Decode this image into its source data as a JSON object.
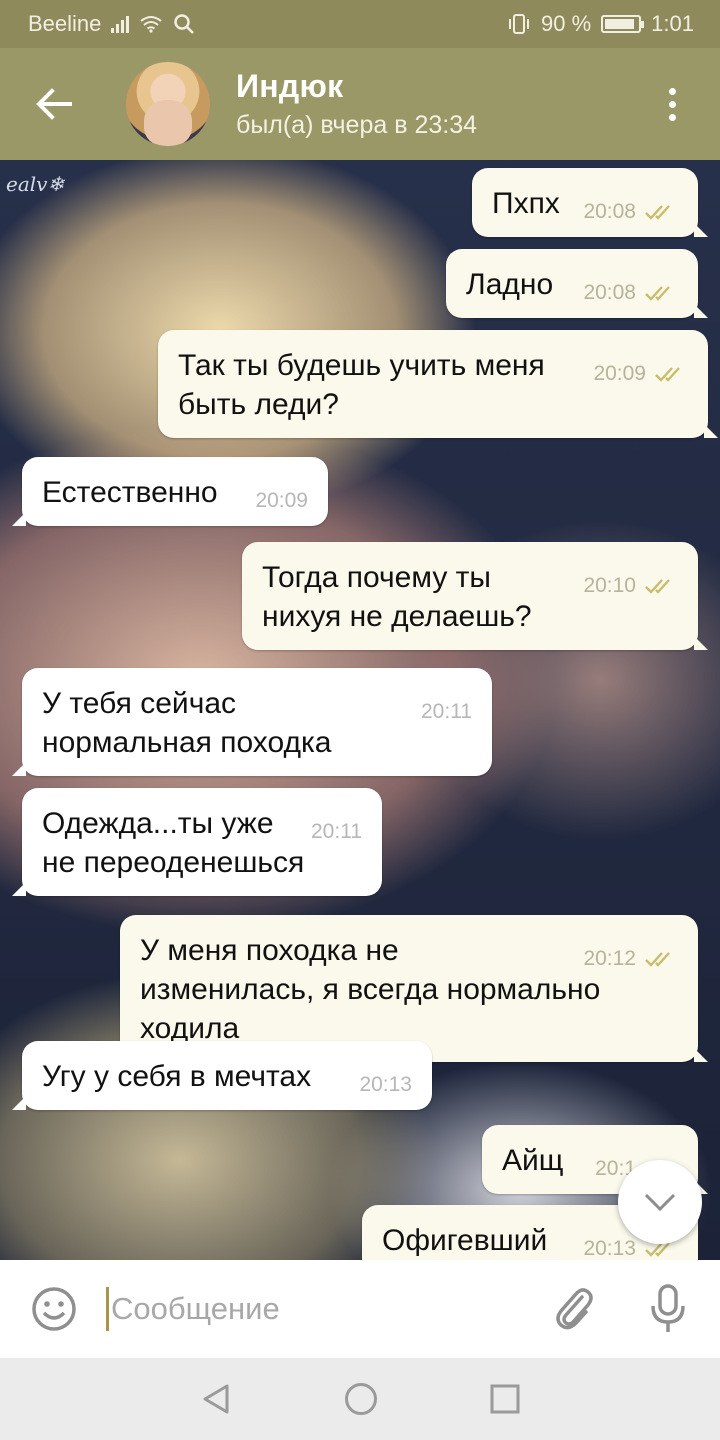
{
  "status_bar": {
    "carrier": "Beeline",
    "battery_percent": "90 %",
    "battery_level": 0.9,
    "time": "1:01"
  },
  "header": {
    "contact_name": "Индюк",
    "last_seen": "был(а) вчера в 23:34"
  },
  "wallpaper": {
    "watermark": "ealv❄"
  },
  "messages": [
    {
      "direction": "out",
      "text": "Пхпх",
      "time": "20:08",
      "status": "read"
    },
    {
      "direction": "out",
      "text": "Ладно",
      "time": "20:08",
      "status": "read"
    },
    {
      "direction": "out",
      "text": "Так ты будешь учить меня быть леди?",
      "time": "20:09",
      "status": "read"
    },
    {
      "direction": "in",
      "text": "Естественно",
      "time": "20:09"
    },
    {
      "direction": "out",
      "text": "Тогда почему ты нихуя не делаешь?",
      "time": "20:10",
      "status": "read"
    },
    {
      "direction": "in",
      "text": "У тебя сейчас нормальная походка",
      "time": "20:11"
    },
    {
      "direction": "in",
      "text": "Одежда...ты уже не переоденешься",
      "time": "20:11"
    },
    {
      "direction": "out",
      "text": "У меня походка не изменилась, я всегда нормально ходила",
      "time": "20:12",
      "status": "read"
    },
    {
      "direction": "in",
      "text": "Угу у себя в мечтах",
      "time": "20:13"
    },
    {
      "direction": "out",
      "text": "Айщ",
      "time": "20:1",
      "status": "read"
    },
    {
      "direction": "out",
      "text": "Офигевший",
      "time": "20:13",
      "status": "read"
    }
  ],
  "composer": {
    "placeholder": "Сообщение"
  },
  "colors": {
    "header": "#9b9867",
    "status_bar": "#8e8a5c",
    "outgoing_bubble": "#fbf9ec",
    "incoming_bubble": "#ffffff",
    "read_check": "#c9bd6c"
  },
  "icons": {
    "back": "arrow-left-icon",
    "menu": "more-vertical-icon",
    "emoji": "smile-icon",
    "attach": "paperclip-icon",
    "mic": "microphone-icon",
    "scroll_down": "chevron-down-icon"
  }
}
